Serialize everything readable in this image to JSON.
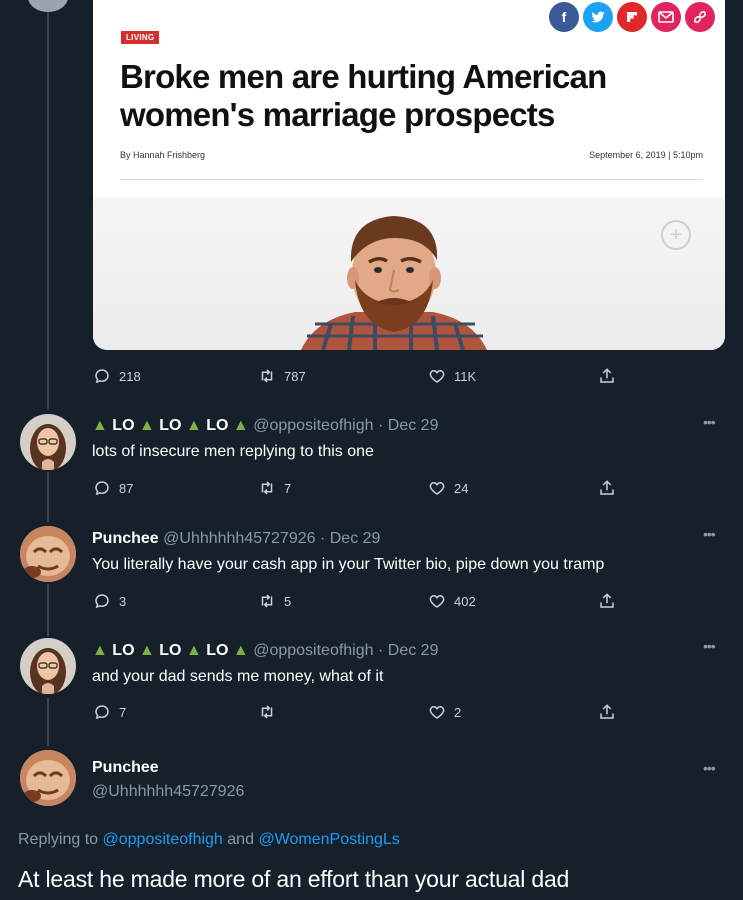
{
  "article": {
    "section_badge": "LIVING",
    "headline": "Broke men are hurting American women's marriage prospects",
    "byline": "By Hannah Frishberg",
    "dateline": "September 6, 2019 | 5:10pm",
    "share_icons": [
      "facebook-icon",
      "twitter-icon",
      "flipboard-icon",
      "email-icon",
      "link-icon"
    ],
    "colors": {
      "badge": "#d32f2f",
      "facebook": "#3b5998",
      "twitter": "#1da1f2",
      "flipboard": "#e12828",
      "email": "#e0245e",
      "link": "#e0245e"
    }
  },
  "original_tweet_stats": {
    "replies": "218",
    "retweets": "787",
    "likes": "11K"
  },
  "replies": [
    {
      "name_parts": [
        "LO",
        "LO",
        "LO"
      ],
      "handle": "@oppositeofhigh",
      "date": "Dec 29",
      "text": "lots of insecure men replying to this one",
      "stats": {
        "replies": "87",
        "retweets": "7",
        "likes": "24"
      }
    },
    {
      "name": "Punchee",
      "handle": "@Uhhhhhh45727926",
      "date": "Dec 29",
      "text": "You literally have your cash app in your Twitter bio, pipe down you tramp",
      "stats": {
        "replies": "3",
        "retweets": "5",
        "likes": "402"
      }
    },
    {
      "name_parts": [
        "LO",
        "LO",
        "LO"
      ],
      "handle": "@oppositeofhigh",
      "date": "Dec 29",
      "text": "and your dad sends me money, what of it",
      "stats": {
        "replies": "7",
        "retweets": "",
        "likes": "2"
      }
    }
  ],
  "focused_tweet": {
    "name": "Punchee",
    "handle": "@Uhhhhhh45727926",
    "replying_prefix": "Replying to",
    "replying_to_1": "@oppositeofhigh",
    "replying_and": "and",
    "replying_to_2": "@WomenPostingLs",
    "text": "At least he made more of an effort than your actual dad"
  },
  "theme": {
    "background": "#15202b",
    "muted": "#8b98a5",
    "link": "#1d9bf0",
    "tree": "#7cb342"
  }
}
